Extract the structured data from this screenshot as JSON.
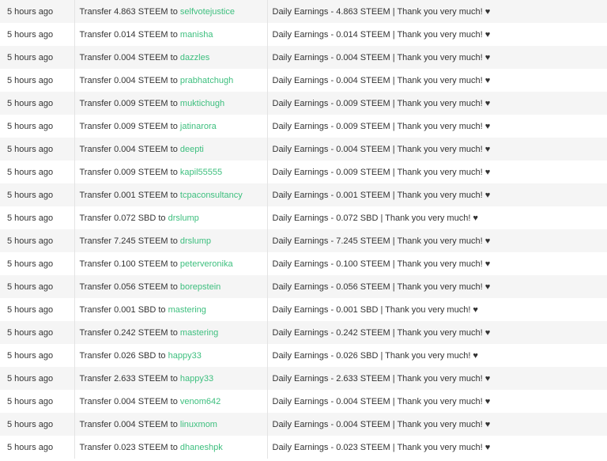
{
  "history": {
    "rows": [
      {
        "time": "5 hours ago",
        "amount": "4.863 STEEM",
        "to": "selfvotejustice",
        "memo": "Daily Earnings - 4.863 STEEM | Thank you very much! ♥"
      },
      {
        "time": "5 hours ago",
        "amount": "0.014 STEEM",
        "to": "manisha",
        "memo": "Daily Earnings - 0.014 STEEM | Thank you very much! ♥"
      },
      {
        "time": "5 hours ago",
        "amount": "0.004 STEEM",
        "to": "dazzles",
        "memo": "Daily Earnings - 0.004 STEEM | Thank you very much! ♥"
      },
      {
        "time": "5 hours ago",
        "amount": "0.004 STEEM",
        "to": "prabhatchugh",
        "memo": "Daily Earnings - 0.004 STEEM | Thank you very much! ♥"
      },
      {
        "time": "5 hours ago",
        "amount": "0.009 STEEM",
        "to": "muktichugh",
        "memo": "Daily Earnings - 0.009 STEEM | Thank you very much! ♥"
      },
      {
        "time": "5 hours ago",
        "amount": "0.009 STEEM",
        "to": "jatinarora",
        "memo": "Daily Earnings - 0.009 STEEM | Thank you very much! ♥"
      },
      {
        "time": "5 hours ago",
        "amount": "0.004 STEEM",
        "to": "deepti",
        "memo": "Daily Earnings - 0.004 STEEM | Thank you very much! ♥"
      },
      {
        "time": "5 hours ago",
        "amount": "0.009 STEEM",
        "to": "kapil55555",
        "memo": "Daily Earnings - 0.009 STEEM | Thank you very much! ♥"
      },
      {
        "time": "5 hours ago",
        "amount": "0.001 STEEM",
        "to": "tcpaconsultancy",
        "memo": "Daily Earnings - 0.001 STEEM | Thank you very much! ♥"
      },
      {
        "time": "5 hours ago",
        "amount": "0.072 SBD",
        "to": "drslump",
        "memo": "Daily Earnings - 0.072 SBD | Thank you very much! ♥"
      },
      {
        "time": "5 hours ago",
        "amount": "7.245 STEEM",
        "to": "drslump",
        "memo": "Daily Earnings - 7.245 STEEM | Thank you very much! ♥"
      },
      {
        "time": "5 hours ago",
        "amount": "0.100 STEEM",
        "to": "peterveronika",
        "memo": "Daily Earnings - 0.100 STEEM | Thank you very much! ♥"
      },
      {
        "time": "5 hours ago",
        "amount": "0.056 STEEM",
        "to": "borepstein",
        "memo": "Daily Earnings - 0.056 STEEM | Thank you very much! ♥"
      },
      {
        "time": "5 hours ago",
        "amount": "0.001 SBD",
        "to": "mastering",
        "memo": "Daily Earnings - 0.001 SBD | Thank you very much! ♥"
      },
      {
        "time": "5 hours ago",
        "amount": "0.242 STEEM",
        "to": "mastering",
        "memo": "Daily Earnings - 0.242 STEEM | Thank you very much! ♥"
      },
      {
        "time": "5 hours ago",
        "amount": "0.026 SBD",
        "to": "happy33",
        "memo": "Daily Earnings - 0.026 SBD | Thank you very much! ♥"
      },
      {
        "time": "5 hours ago",
        "amount": "2.633 STEEM",
        "to": "happy33",
        "memo": "Daily Earnings - 2.633 STEEM | Thank you very much! ♥"
      },
      {
        "time": "5 hours ago",
        "amount": "0.004 STEEM",
        "to": "venom642",
        "memo": "Daily Earnings - 0.004 STEEM | Thank you very much! ♥"
      },
      {
        "time": "5 hours ago",
        "amount": "0.004 STEEM",
        "to": "linuxmom",
        "memo": "Daily Earnings - 0.004 STEEM | Thank you very much! ♥"
      },
      {
        "time": "5 hours ago",
        "amount": "0.023 STEEM",
        "to": "dhaneshpk",
        "memo": "Daily Earnings - 0.023 STEEM | Thank you very much! ♥"
      }
    ],
    "transfer_word": "Transfer",
    "to_word": "to"
  },
  "colors": {
    "link": "#3dbf7e",
    "text": "#333333",
    "stripe": "#f5f5f5"
  }
}
